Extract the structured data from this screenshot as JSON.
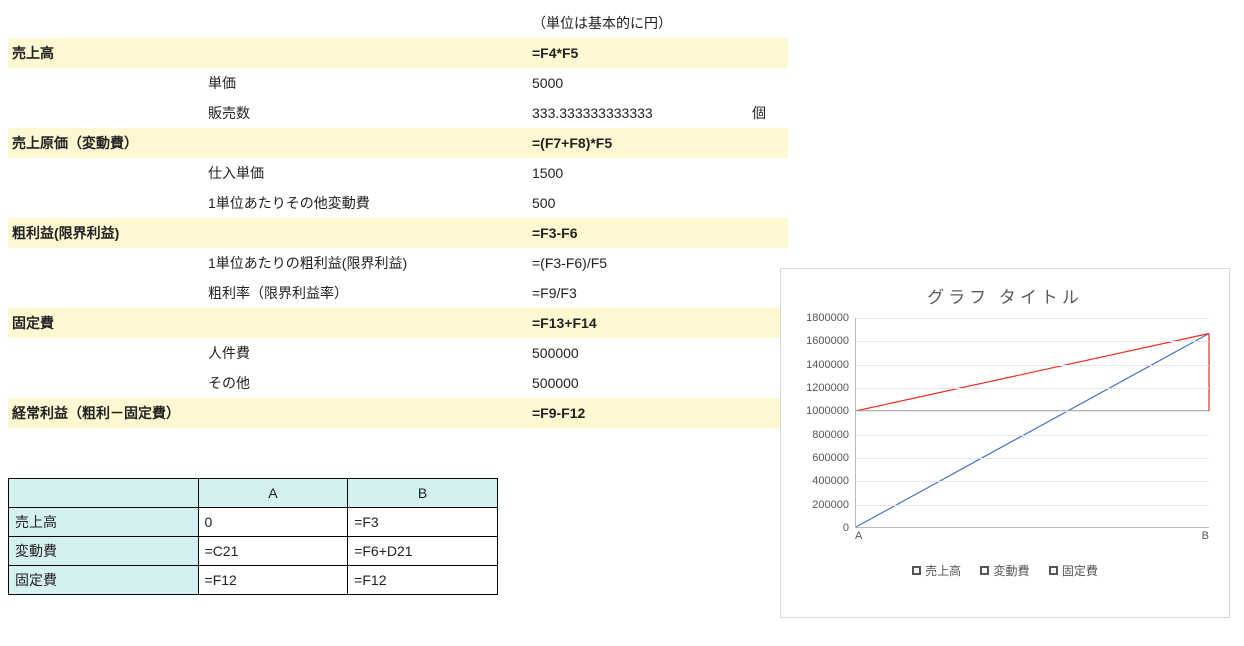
{
  "note": "（単位は基本的に円）",
  "rows": [
    {
      "labelA": "売上高",
      "labelB": "",
      "value": "=F4*F5",
      "hilite": true
    },
    {
      "labelA": "",
      "labelB": "単価",
      "value": "5000"
    },
    {
      "labelA": "",
      "labelB": "販売数",
      "value": "333.333333333333",
      "unit": "個"
    },
    {
      "labelA": "売上原価（変動費）",
      "labelB": "",
      "value": "=(F7+F8)*F5",
      "hilite": true
    },
    {
      "labelA": "",
      "labelB": "仕入単価",
      "value": "1500"
    },
    {
      "labelA": "",
      "labelB": "1単位あたりその他変動費",
      "value": "500"
    },
    {
      "labelA": "粗利益(限界利益)",
      "labelB": "",
      "value": "=F3-F6",
      "hilite": true
    },
    {
      "labelA": "",
      "labelB": "1単位あたりの粗利益(限界利益)",
      "value": "=(F3-F6)/F5"
    },
    {
      "labelA": "",
      "labelB": "粗利率（限界利益率）",
      "value": "=F9/F3"
    },
    {
      "labelA": "固定費",
      "labelB": "",
      "value": "=F13+F14",
      "hilite": true
    },
    {
      "labelA": "",
      "labelB": "人件費",
      "value": "500000"
    },
    {
      "labelA": "",
      "labelB": "その他",
      "value": "500000"
    },
    {
      "labelA": "経常利益（粗利－固定費）",
      "labelB": "",
      "value": "=F9-F12",
      "hilite": true
    }
  ],
  "mini": {
    "headers": [
      "",
      "A",
      "B"
    ],
    "rows": [
      [
        "売上高",
        "0",
        "=F3"
      ],
      [
        "変動費",
        "=C21",
        "=F6+D21"
      ],
      [
        "固定費",
        "=F12",
        "=F12"
      ]
    ]
  },
  "chart_data": {
    "type": "line",
    "title": "グラフ タイトル",
    "categories": [
      "A",
      "B"
    ],
    "ylim": [
      0,
      1800000
    ],
    "y_ticks": [
      0,
      200000,
      400000,
      600000,
      800000,
      1000000,
      1200000,
      1400000,
      1600000,
      1800000
    ],
    "series": [
      {
        "name": "売上高",
        "color": "#4472c4",
        "values": [
          0,
          1666667
        ]
      },
      {
        "name": "変動費",
        "color": "#ed2b1c",
        "values": [
          1000000,
          1666667
        ]
      },
      {
        "name": "固定費",
        "color": "#9b9b9b",
        "values": [
          1000000,
          1000000
        ]
      }
    ],
    "legend": [
      "売上高",
      "変動費",
      "固定費"
    ]
  }
}
